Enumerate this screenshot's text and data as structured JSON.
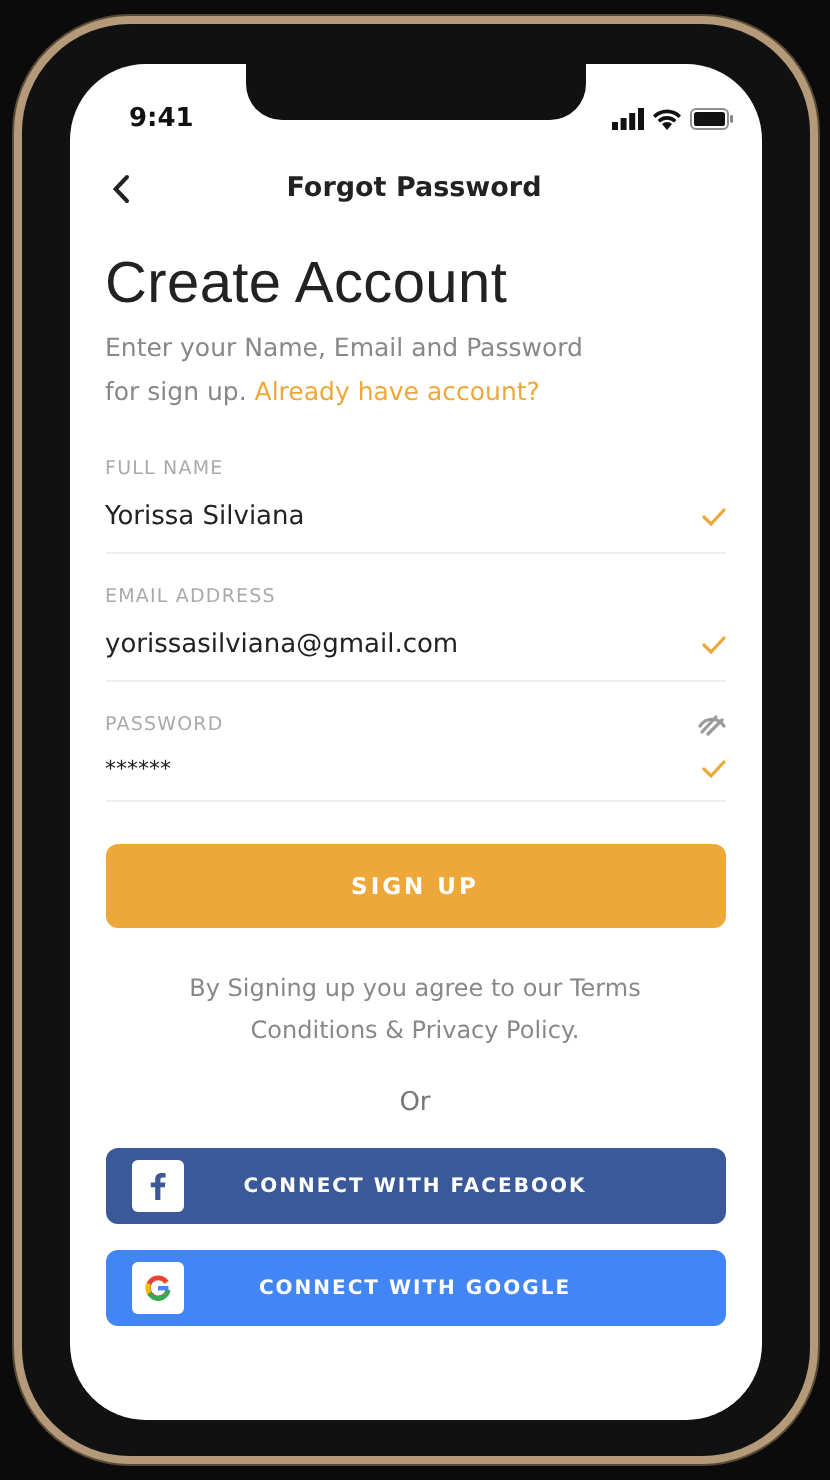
{
  "status_bar": {
    "time": "9:41"
  },
  "nav": {
    "title": "Forgot Password"
  },
  "heading": "Create Account",
  "intro": {
    "text": "Enter your Name, Email and Password for sign up.",
    "link": "Already have account?"
  },
  "fields": [
    {
      "kind": "text",
      "label": "FULL NAME",
      "value": "Yorissa Silviana",
      "valid": true
    },
    {
      "kind": "text",
      "label": "EMAIL ADDRESS",
      "value": "yorissasilviana@gmail.com",
      "valid": true
    },
    {
      "kind": "password",
      "label": "PASSWORD",
      "value": "******",
      "valid": true
    }
  ],
  "primary_button": "SIGN UP",
  "terms": "By Signing up you agree to our Terms Conditions & Privacy Policy.",
  "divider_text": "Or",
  "social_buttons": [
    {
      "kind": "facebook",
      "label": "CONNECT WITH FACEBOOK"
    },
    {
      "kind": "google",
      "label": "CONNECT WITH GOOGLE"
    }
  ]
}
